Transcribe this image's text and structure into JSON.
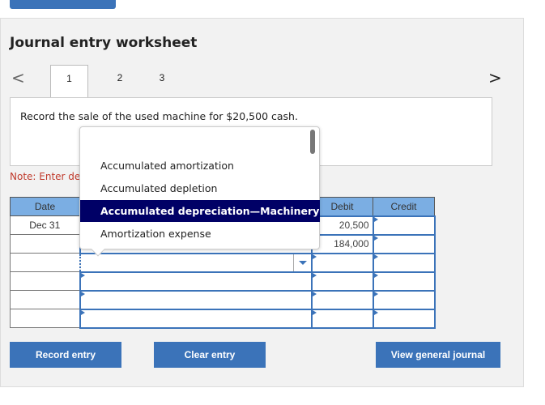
{
  "title": "Journal entry worksheet",
  "nav": {
    "prev": "<",
    "next": ">",
    "tabs": [
      "1",
      "2",
      "3"
    ]
  },
  "instruction": "Record the sale of the used machine for $20,500 cash.",
  "note": "Note: Enter de",
  "table": {
    "headers": [
      "Date",
      "",
      "Debit",
      "Credit"
    ],
    "rows": [
      {
        "date": "Dec 31",
        "account": "",
        "debit": "20,500",
        "credit": ""
      },
      {
        "date": "",
        "account": "",
        "debit": "184,000",
        "credit": ""
      },
      {
        "date": "",
        "account": "",
        "debit": "",
        "credit": ""
      },
      {
        "date": "",
        "account": "",
        "debit": "",
        "credit": ""
      },
      {
        "date": "",
        "account": "",
        "debit": "",
        "credit": ""
      },
      {
        "date": "",
        "account": "",
        "debit": "",
        "credit": ""
      }
    ]
  },
  "dropdown": {
    "options": [
      "Accumulated amortization",
      "Accumulated depletion",
      "Accumulated depreciation—Machinery",
      "Amortization expense"
    ],
    "highlighted": "Accumulated depreciation—Machinery"
  },
  "buttons": {
    "record": "Record entry",
    "clear": "Clear entry",
    "view": "View general journal"
  },
  "colors": {
    "accent": "#3b73b9",
    "header": "#7baee3",
    "highlight": "#000066",
    "note": "#c0392b"
  }
}
